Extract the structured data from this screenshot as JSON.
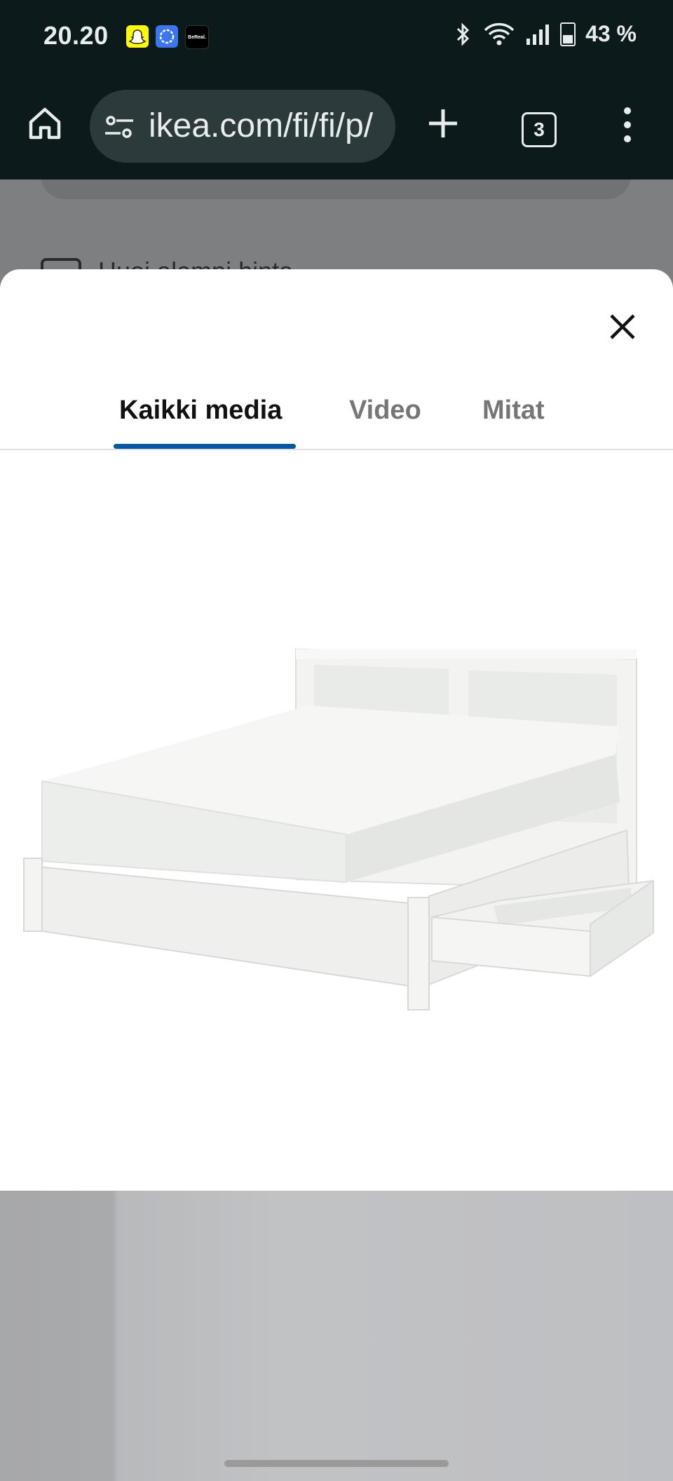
{
  "status_bar": {
    "time": "20.20",
    "battery": "43 %",
    "bereal_label": "BeReal."
  },
  "browser": {
    "url": "ikea.com/fi/fi/p/",
    "tab_count": "3"
  },
  "background_page": {
    "checkbox_label": "Huoi alempi hinta"
  },
  "media_modal": {
    "tabs": [
      {
        "label": "Kaikki media",
        "active": true
      },
      {
        "label": "Video",
        "active": false
      },
      {
        "label": "Mitat",
        "active": false
      }
    ],
    "accent_color": "#0058a3"
  }
}
